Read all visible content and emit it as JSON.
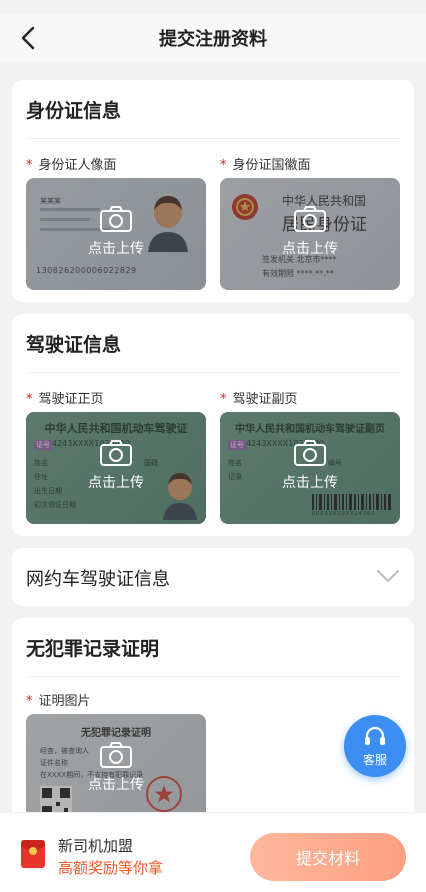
{
  "nav": {
    "title": "提交注册资料"
  },
  "id_card": {
    "title": "身份证信息",
    "front_label": "身份证人像面",
    "back_label": "身份证国徽面",
    "front_name": "某某某",
    "front_number": "130826200006022829",
    "back_title": "中华人民共和国",
    "back_subtitle": "居民身份证",
    "back_authority": "签发机关",
    "back_authority_value": "北京市****",
    "back_valid": "有效期限",
    "back_valid_value": "****.**.**"
  },
  "driver_license": {
    "title": "驾驶证信息",
    "main_label": "驾驶证正页",
    "sub_label": "驾驶证副页",
    "main_card_title": "中华人民共和国机动车驾驶证",
    "sub_card_title": "中华人民共和国机动车驾驶证副页",
    "tag": "证号",
    "number": "4243XXXX1020000",
    "row_name": "姓名",
    "row_address": "住址",
    "row_birth": "出生日期",
    "row_first": "初次领证日期",
    "row_nationality": "国籍",
    "sub_row_name": "姓名",
    "sub_row_record": "记录",
    "sub_row_number": "编号",
    "barcode_number": "0003X810XX24360"
  },
  "ride_hailing": {
    "title": "网约车驾驶证信息"
  },
  "criminal_record": {
    "title": "无犯罪记录证明",
    "photo_label": "证明图片",
    "card_title": "无犯罪记录证明",
    "line1": "经查，被查询人",
    "line2": "证件名称",
    "line3": "在XXXX期间，不支持有犯罪记录"
  },
  "upload_text": "点击上传",
  "customer_service": {
    "label": "客服"
  },
  "bottom": {
    "promo_line1": "新司机加盟",
    "promo_line2": "高额奖励等你拿",
    "submit_label": "提交材料"
  },
  "colors": {
    "accent": "#f05a28",
    "service_blue": "#3c8ef3",
    "submit_bg": "#ffa98c",
    "required_star": "#e02020"
  }
}
